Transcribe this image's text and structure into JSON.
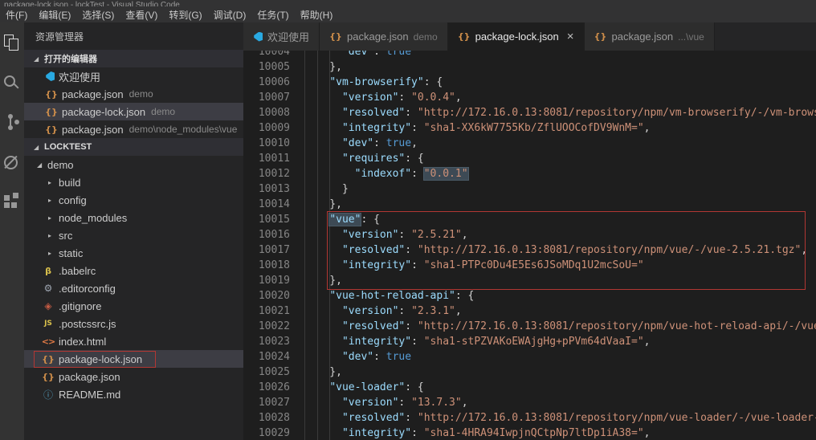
{
  "window": {
    "title": "package-lock.json - lockTest - Visual Studio Code"
  },
  "menu": {
    "items": [
      "件(F)",
      "编辑(E)",
      "选择(S)",
      "查看(V)",
      "转到(G)",
      "调试(D)",
      "任务(T)",
      "帮助(H)"
    ]
  },
  "icons": {
    "expanded": "◢",
    "collapsed": "▸",
    "close": "×"
  },
  "file_icon_glyphs": {
    "json": "{}",
    "js": "JS",
    "html": "<>",
    "info": "ⓘ",
    "editorconfig": "⚙",
    "git": "◈",
    "babel": "β",
    "vscode": ""
  },
  "activity_bar": {
    "items": [
      "explorer-icon",
      "search-icon",
      "source-control-icon",
      "debug-icon",
      "extensions-icon"
    ]
  },
  "sidebar": {
    "title": "资源管理器",
    "open_editors": {
      "header": "打开的编辑器",
      "items": [
        {
          "icon": "vscode",
          "label": "欢迎使用"
        },
        {
          "icon": "json",
          "label": "package.json",
          "detail": "demo"
        },
        {
          "icon": "json",
          "label": "package-lock.json",
          "detail": "demo",
          "selected": true
        },
        {
          "icon": "json",
          "label": "package.json",
          "detail": "demo\\node_modules\\vue"
        }
      ]
    },
    "tree": {
      "header": "LOCKTEST",
      "items": [
        {
          "kind": "folder",
          "open": true,
          "indent": 0,
          "label": "demo"
        },
        {
          "kind": "folder",
          "open": false,
          "indent": 1,
          "label": "build"
        },
        {
          "kind": "folder",
          "open": false,
          "indent": 1,
          "label": "config"
        },
        {
          "kind": "folder",
          "open": false,
          "indent": 1,
          "label": "node_modules"
        },
        {
          "kind": "folder",
          "open": false,
          "indent": 1,
          "label": "src"
        },
        {
          "kind": "folder",
          "open": false,
          "indent": 1,
          "label": "static"
        },
        {
          "kind": "file",
          "icon": "babel",
          "indent": 1,
          "label": ".babelrc"
        },
        {
          "kind": "file",
          "icon": "editorconfig",
          "indent": 1,
          "label": ".editorconfig"
        },
        {
          "kind": "file",
          "icon": "git",
          "indent": 1,
          "label": ".gitignore"
        },
        {
          "kind": "file",
          "icon": "js",
          "indent": 1,
          "label": ".postcssrc.js"
        },
        {
          "kind": "file",
          "icon": "html",
          "indent": 1,
          "label": "index.html"
        },
        {
          "kind": "file",
          "icon": "json",
          "indent": 1,
          "label": "package-lock.json",
          "selected": true,
          "annotated": true
        },
        {
          "kind": "file",
          "icon": "json",
          "indent": 1,
          "label": "package.json"
        },
        {
          "kind": "file",
          "icon": "info",
          "indent": 1,
          "label": "README.md"
        }
      ]
    }
  },
  "tabs": [
    {
      "icon": "vscode",
      "label": "欢迎使用"
    },
    {
      "icon": "json",
      "label": "package.json",
      "detail": "demo"
    },
    {
      "icon": "json",
      "label": "package-lock.json",
      "active": true,
      "close": "×"
    },
    {
      "icon": "json",
      "label": "package.json",
      "detail": "...\\vue"
    }
  ],
  "editor": {
    "lines": [
      {
        "num": "10004",
        "tokens": [
          [
            "p",
            "      "
          ],
          [
            "k",
            "\"dev\""
          ],
          [
            "p",
            ": "
          ],
          [
            "b",
            "true"
          ]
        ]
      },
      {
        "num": "10005",
        "tokens": [
          [
            "p",
            "    },"
          ]
        ]
      },
      {
        "num": "10006",
        "tokens": [
          [
            "p",
            "    "
          ],
          [
            "k",
            "\"vm-browserify\""
          ],
          [
            "p",
            ": {"
          ]
        ]
      },
      {
        "num": "10007",
        "tokens": [
          [
            "p",
            "      "
          ],
          [
            "k",
            "\"version\""
          ],
          [
            "p",
            ": "
          ],
          [
            "s",
            "\"0.0.4\""
          ],
          [
            "p",
            ","
          ]
        ]
      },
      {
        "num": "10008",
        "tokens": [
          [
            "p",
            "      "
          ],
          [
            "k",
            "\"resolved\""
          ],
          [
            "p",
            ": "
          ],
          [
            "s",
            "\"http://172.16.0.13:8081/repository/npm/vm-browserify/-/vm-brows"
          ]
        ]
      },
      {
        "num": "10009",
        "tokens": [
          [
            "p",
            "      "
          ],
          [
            "k",
            "\"integrity\""
          ],
          [
            "p",
            ": "
          ],
          [
            "s",
            "\"sha1-XX6kW7755Kb/ZflUOOCofDV9WnM=\""
          ],
          [
            "p",
            ","
          ]
        ]
      },
      {
        "num": "10010",
        "tokens": [
          [
            "p",
            "      "
          ],
          [
            "k",
            "\"dev\""
          ],
          [
            "p",
            ": "
          ],
          [
            "b",
            "true"
          ],
          [
            "p",
            ","
          ]
        ]
      },
      {
        "num": "10011",
        "tokens": [
          [
            "p",
            "      "
          ],
          [
            "k",
            "\"requires\""
          ],
          [
            "p",
            ": {"
          ]
        ]
      },
      {
        "num": "10012",
        "tokens": [
          [
            "p",
            "        "
          ],
          [
            "k",
            "\"indexof\""
          ],
          [
            "p",
            ": "
          ],
          [
            "s",
            "\"0.0.1\"",
            1
          ]
        ]
      },
      {
        "num": "10013",
        "tokens": [
          [
            "p",
            "      }"
          ]
        ]
      },
      {
        "num": "10014",
        "tokens": [
          [
            "p",
            "    },"
          ]
        ]
      },
      {
        "num": "10015",
        "tokens": [
          [
            "p",
            "    "
          ],
          [
            "k",
            "\"vue\"",
            1
          ],
          [
            "p",
            ": {"
          ]
        ]
      },
      {
        "num": "10016",
        "tokens": [
          [
            "p",
            "      "
          ],
          [
            "k",
            "\"version\""
          ],
          [
            "p",
            ": "
          ],
          [
            "s",
            "\"2.5.21\""
          ],
          [
            "p",
            ","
          ]
        ]
      },
      {
        "num": "10017",
        "tokens": [
          [
            "p",
            "      "
          ],
          [
            "k",
            "\"resolved\""
          ],
          [
            "p",
            ": "
          ],
          [
            "s",
            "\"http://172.16.0.13:8081/repository/npm/vue/-/vue-2.5.21.tgz\""
          ],
          [
            "p",
            ","
          ]
        ]
      },
      {
        "num": "10018",
        "tokens": [
          [
            "p",
            "      "
          ],
          [
            "k",
            "\"integrity\""
          ],
          [
            "p",
            ": "
          ],
          [
            "s",
            "\"sha1-PTPc0Du4E5Es6JSoMDq1U2mcSoU=\""
          ]
        ]
      },
      {
        "num": "10019",
        "tokens": [
          [
            "p",
            "    },"
          ]
        ]
      },
      {
        "num": "10020",
        "tokens": [
          [
            "p",
            "    "
          ],
          [
            "k",
            "\"vue-hot-reload-api\""
          ],
          [
            "p",
            ": {"
          ]
        ]
      },
      {
        "num": "10021",
        "tokens": [
          [
            "p",
            "      "
          ],
          [
            "k",
            "\"version\""
          ],
          [
            "p",
            ": "
          ],
          [
            "s",
            "\"2.3.1\""
          ],
          [
            "p",
            ","
          ]
        ]
      },
      {
        "num": "10022",
        "tokens": [
          [
            "p",
            "      "
          ],
          [
            "k",
            "\"resolved\""
          ],
          [
            "p",
            ": "
          ],
          [
            "s",
            "\"http://172.16.0.13:8081/repository/npm/vue-hot-reload-api/-/vue"
          ]
        ]
      },
      {
        "num": "10023",
        "tokens": [
          [
            "p",
            "      "
          ],
          [
            "k",
            "\"integrity\""
          ],
          [
            "p",
            ": "
          ],
          [
            "s",
            "\"sha1-stPZVAKoEWAjgHg+pPVm64dVaaI=\""
          ],
          [
            "p",
            ","
          ]
        ]
      },
      {
        "num": "10024",
        "tokens": [
          [
            "p",
            "      "
          ],
          [
            "k",
            "\"dev\""
          ],
          [
            "p",
            ": "
          ],
          [
            "b",
            "true"
          ]
        ]
      },
      {
        "num": "10025",
        "tokens": [
          [
            "p",
            "    },"
          ]
        ]
      },
      {
        "num": "10026",
        "tokens": [
          [
            "p",
            "    "
          ],
          [
            "k",
            "\"vue-loader\""
          ],
          [
            "p",
            ": {"
          ]
        ]
      },
      {
        "num": "10027",
        "tokens": [
          [
            "p",
            "      "
          ],
          [
            "k",
            "\"version\""
          ],
          [
            "p",
            ": "
          ],
          [
            "s",
            "\"13.7.3\""
          ],
          [
            "p",
            ","
          ]
        ]
      },
      {
        "num": "10028",
        "tokens": [
          [
            "p",
            "      "
          ],
          [
            "k",
            "\"resolved\""
          ],
          [
            "p",
            ": "
          ],
          [
            "s",
            "\"http://172.16.0.13:8081/repository/npm/vue-loader/-/vue-loader-"
          ]
        ]
      },
      {
        "num": "10029",
        "tokens": [
          [
            "p",
            "      "
          ],
          [
            "k",
            "\"integrity\""
          ],
          [
            "p",
            ": "
          ],
          [
            "s",
            "\"sha1-4HRA94IwpjnQCtpNp7ltDp1iA38=\""
          ],
          [
            "p",
            ","
          ]
        ]
      }
    ]
  },
  "annotations": {
    "color": "#b23733",
    "boxes": [
      "sidebar package-lock.json row",
      "editor vue dependency block lines 10015-10019"
    ]
  },
  "colors": {
    "json_key": "#9cdcfe",
    "json_string": "#ce9178",
    "json_keyword": "#569cd6",
    "line_number": "#858585",
    "editor_bg": "#1e1e1e",
    "annotation_red": "#b23733"
  }
}
